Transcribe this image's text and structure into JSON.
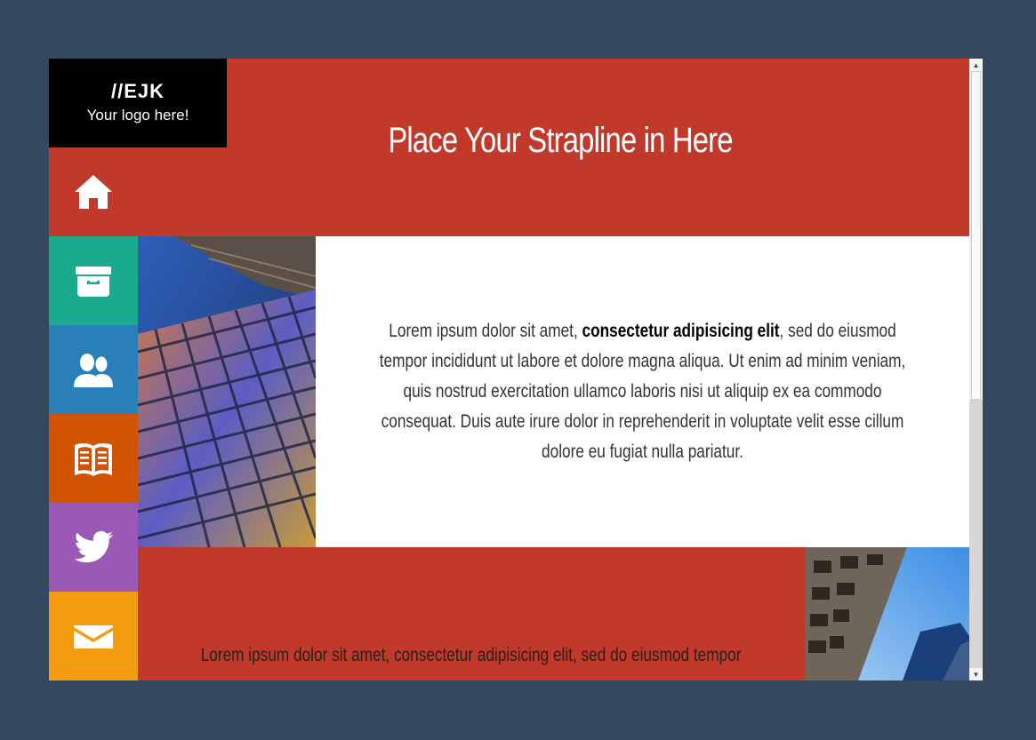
{
  "logo": {
    "mark": "//EJK",
    "tagline": "Your logo here!"
  },
  "header": {
    "strapline": "Place Your Strapline in Here"
  },
  "nav": [
    {
      "name": "home",
      "color": "#c0392b",
      "icon": "home-icon"
    },
    {
      "name": "archive",
      "color": "#1aaa8e",
      "icon": "archive-icon"
    },
    {
      "name": "users",
      "color": "#2980b9",
      "icon": "users-icon"
    },
    {
      "name": "book",
      "color": "#d35400",
      "icon": "book-icon"
    },
    {
      "name": "twitter",
      "color": "#9b59b6",
      "icon": "twitter-icon"
    },
    {
      "name": "mail",
      "color": "#f39c12",
      "icon": "mail-icon"
    }
  ],
  "content": {
    "intro_before": "Lorem ipsum dolor sit amet, ",
    "intro_bold": "consectetur adipisicing elit",
    "intro_after": ", sed do eiusmod tempor incididunt ut labore et dolore magna aliqua. Ut enim ad minim veniam, quis nostrud exercitation ullamco laboris nisi ut aliquip ex ea commodo consequat. Duis aute irure dolor in reprehenderit in voluptate velit esse cillum dolore eu fugiat nulla pariatur.",
    "second_text": "Lorem ipsum dolor sit amet, consectetur adipisicing elit, sed do eiusmod tempor"
  },
  "scrollbar": {
    "up_arrow": "▲",
    "down_arrow": "▼"
  }
}
